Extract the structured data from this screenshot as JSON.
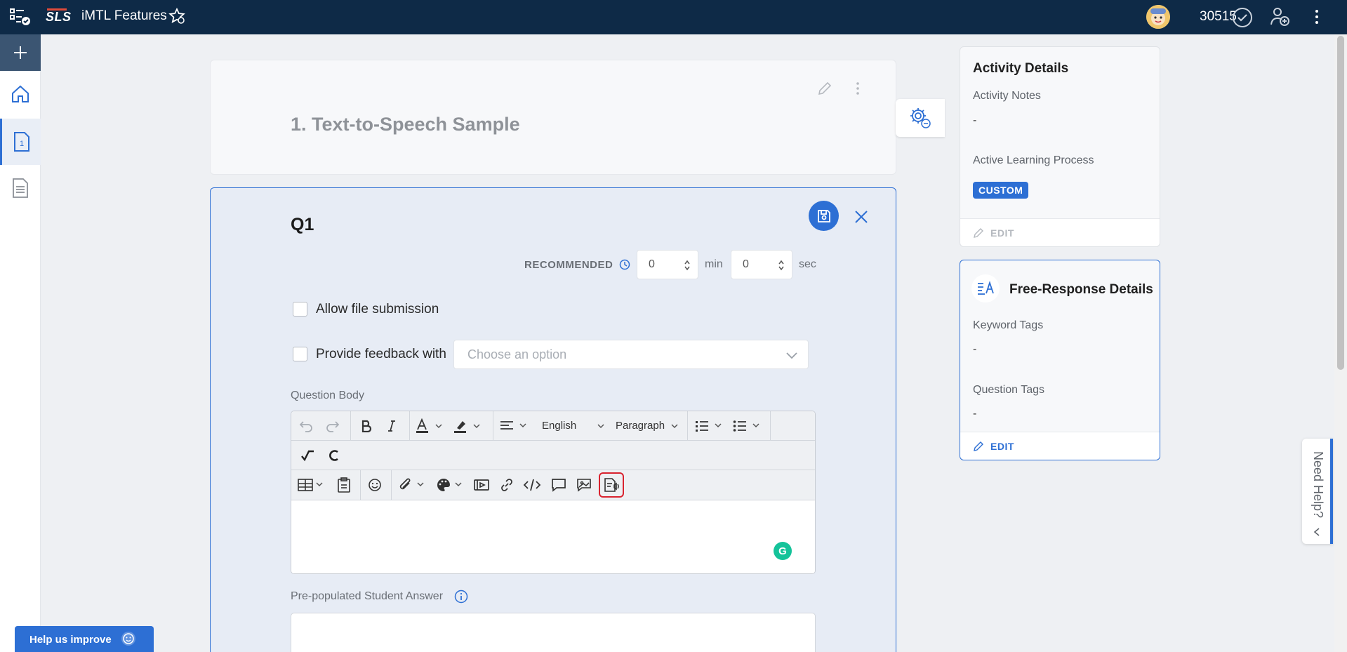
{
  "topbar": {
    "logo": "SLS",
    "title": "iMTL Features",
    "points": "30515"
  },
  "activity": {
    "title": "1. Text-to-Speech Sample"
  },
  "question": {
    "label": "Q1",
    "recommended_label": "RECOMMENDED",
    "min_value": "0",
    "min_unit": "min",
    "sec_value": "0",
    "sec_unit": "sec",
    "allow_file_label": "Allow file submission",
    "feedback_label": "Provide feedback with",
    "feedback_placeholder": "Choose an option",
    "body_label": "Question Body",
    "answer_label": "Pre-populated Student Answer"
  },
  "editor": {
    "language": "English",
    "block_format": "Paragraph"
  },
  "activity_details": {
    "heading": "Activity Details",
    "notes_label": "Activity Notes",
    "notes_value": "-",
    "process_label": "Active Learning Process",
    "process_badge": "CUSTOM",
    "edit_label": "EDIT"
  },
  "free_response": {
    "heading": "Free-Response Details",
    "keyword_label": "Keyword Tags",
    "keyword_value": "-",
    "question_tags_label": "Question Tags",
    "question_tags_value": "-",
    "edit_label": "EDIT"
  },
  "need_help": "Need Help?",
  "help_improve": "Help us improve",
  "colors": {
    "topbar": "#0e2a47",
    "accent": "#2d6fd4",
    "highlight": "#d9232f",
    "grammarly": "#15c39a"
  }
}
